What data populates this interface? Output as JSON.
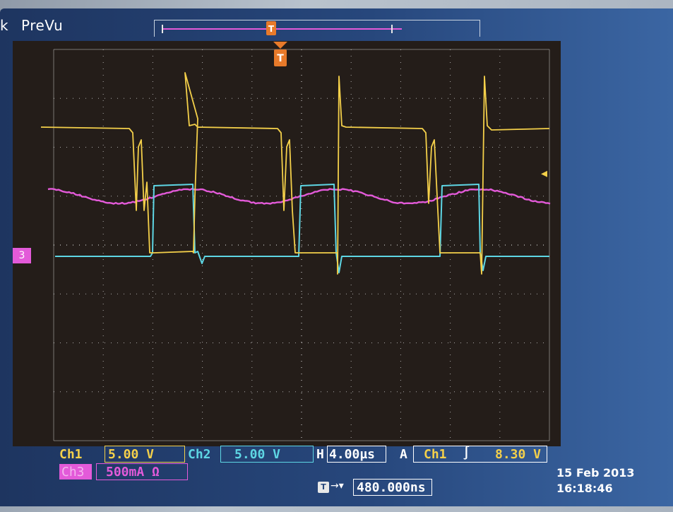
{
  "header": {
    "prefix": "k",
    "mode_label": "PreVu"
  },
  "markers": {
    "trigger_marker": "T",
    "trigger_marker_top": "T",
    "ch3_ground_marker": "3"
  },
  "status": {
    "ch1_label": "Ch1",
    "ch1_scale": "5.00 V",
    "ch2_label": "Ch2",
    "ch2_scale": "5.00 V",
    "h_label": "H",
    "h_scale": "4.00µs",
    "a_label": "A",
    "trigger_source": "Ch1",
    "trigger_slope_icon": "rising-edge-icon",
    "trigger_level": "8.30 V",
    "ch3_label": "Ch3",
    "ch3_scale": "500mA Ω",
    "delay_icon": "trigger-offset-icon",
    "delay_value": "480.000ns",
    "date": "15 Feb  2013",
    "time": "16:18:46"
  },
  "colors": {
    "ch1": "#f4d04a",
    "ch2": "#5ed6e4",
    "ch3": "#e35ad9",
    "grid": "#cfcfcf",
    "screen_bg": "#241d19"
  }
}
